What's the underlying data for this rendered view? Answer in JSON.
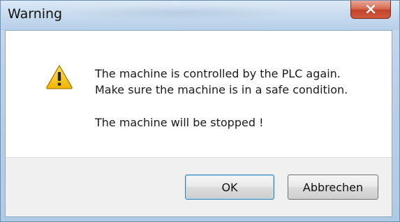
{
  "window": {
    "title": "Warning"
  },
  "dialog": {
    "icon": "warning-triangle-icon",
    "message_lines": [
      "The machine is controlled by the PLC again.",
      "Make sure the machine is in a safe condition.",
      "The machine will be stopped !"
    ]
  },
  "buttons": {
    "ok_label": "OK",
    "cancel_label": "Abbrechen"
  },
  "colors": {
    "close_button": "#c2432a",
    "warning_icon_fill": "#f5c400",
    "ok_button_focus": "#3c7fb1"
  }
}
